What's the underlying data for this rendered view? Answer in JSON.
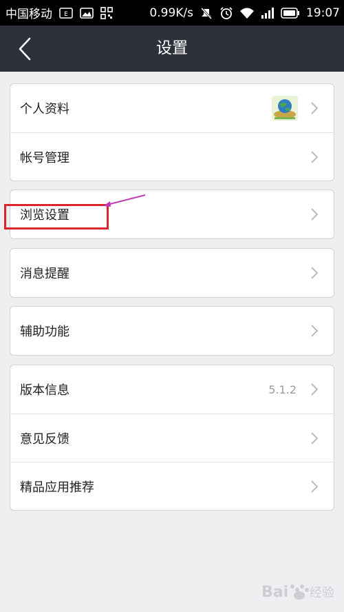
{
  "status_bar": {
    "carrier": "中国移动",
    "speed": "0.99K/s",
    "time": "19:07",
    "icons": [
      "edge-e-icon",
      "image-icon",
      "qr-icon",
      "mute-icon",
      "alarm-icon",
      "wifi-icon",
      "signal-icon",
      "battery-icon"
    ]
  },
  "header": {
    "title": "设置",
    "back_icon": "chevron-left-icon"
  },
  "groups": [
    {
      "rows": [
        {
          "label": "个人资料",
          "has_avatar": true
        },
        {
          "label": "帐号管理"
        }
      ]
    },
    {
      "rows": [
        {
          "label": "浏览设置"
        }
      ]
    },
    {
      "rows": [
        {
          "label": "消息提醒"
        }
      ]
    },
    {
      "rows": [
        {
          "label": "辅助功能"
        }
      ]
    },
    {
      "rows": [
        {
          "label": "版本信息",
          "value": "5.1.2"
        },
        {
          "label": "意见反馈"
        },
        {
          "label": "精品应用推荐"
        }
      ]
    }
  ],
  "watermark": "Bai 经验",
  "colors": {
    "header_bg": "#2c313b",
    "page_bg": "#efeff1",
    "highlight": "#d8262b",
    "arrow": "#c23bb6"
  }
}
